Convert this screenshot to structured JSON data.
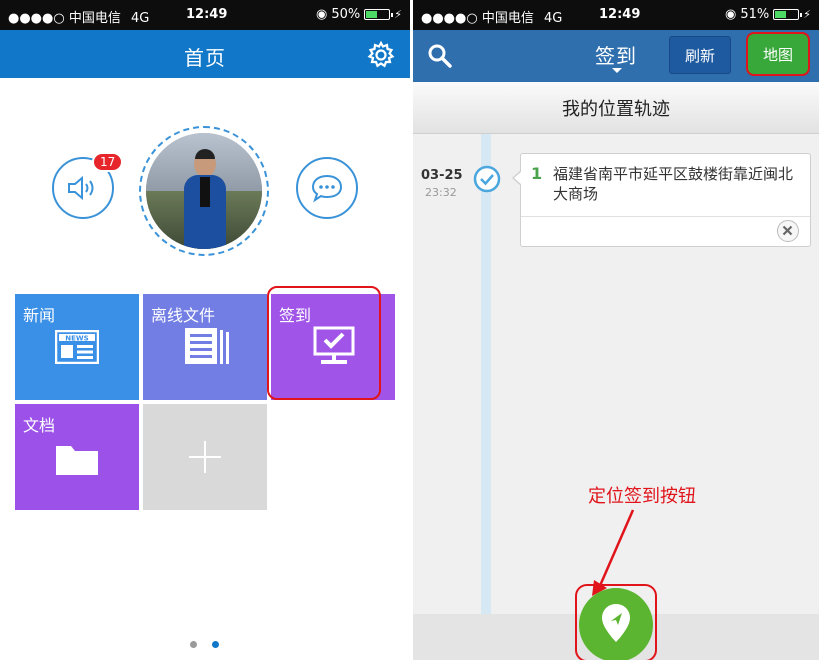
{
  "left_screen": {
    "status_bar": {
      "carrier": "●●●●○ 中国电信",
      "network": "4G",
      "time": "12:49",
      "battery": "50%",
      "battery_fraction": 0.5
    },
    "nav": {
      "title": "首页",
      "settings_icon": "gear-icon"
    },
    "profile": {
      "speaker_badge": "17",
      "speaker_icon": "speaker-icon",
      "chat_icon": "chat-bubble-icon"
    },
    "tiles": [
      {
        "label": "新闻",
        "icon": "news-icon",
        "color": "#3a8fe6"
      },
      {
        "label": "离线文件",
        "icon": "document-stack-icon",
        "color": "#727ee3"
      },
      {
        "label": "签到",
        "icon": "monitor-check-icon",
        "color": "#a055e8"
      },
      {
        "label": "文档",
        "icon": "folder-icon",
        "color": "#9c52e8"
      },
      {
        "label": "",
        "icon": "plus-icon",
        "color": "#d9d9d9"
      }
    ],
    "page_dots": {
      "count": 2,
      "active": 1
    }
  },
  "right_screen": {
    "status_bar": {
      "carrier": "●●●●○ 中国电信",
      "network": "4G",
      "time": "12:49",
      "battery": "51%",
      "battery_fraction": 0.51
    },
    "nav": {
      "title": "签到",
      "refresh_label": "刷新",
      "map_label": "地图",
      "search_icon": "search-icon"
    },
    "banner_title": "我的位置轨迹",
    "entry": {
      "date": "03-25",
      "time": "23:32",
      "index": "1",
      "address": "福建省南平市延平区鼓楼街靠近闽北大商场"
    },
    "annotation": "定位签到按钮",
    "colors": {
      "accent_green": "#5cb531",
      "annotation_red": "#e0141a",
      "nav_blue": "#2f6fae"
    }
  }
}
